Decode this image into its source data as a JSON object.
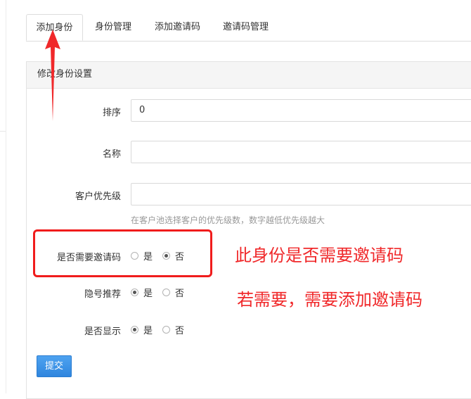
{
  "tabs": [
    {
      "label": "添加身份",
      "active": true
    },
    {
      "label": "身份管理",
      "active": false
    },
    {
      "label": "添加邀请码",
      "active": false
    },
    {
      "label": "邀请码管理",
      "active": false
    }
  ],
  "panel": {
    "title": "修改身份设置"
  },
  "form": {
    "sort": {
      "label": "排序",
      "value": "0"
    },
    "name": {
      "label": "名称",
      "value": ""
    },
    "priority": {
      "label": "客户优先级",
      "value": "",
      "hint": "在客户池选择客户的优先级数，数字越低优先级越大"
    },
    "need_invite": {
      "label": "是否需要邀请码",
      "yes": "是",
      "no": "否",
      "selected": "no"
    },
    "hidden_recommend": {
      "label": "隐号推荐",
      "yes": "是",
      "no": "否",
      "selected": "yes"
    },
    "display": {
      "label": "是否显示",
      "yes": "是",
      "no": "否",
      "selected": "yes"
    },
    "submit_label": "提交"
  },
  "annotations": {
    "note1": "此身份是否需要邀请码",
    "note2": "若需要，需要添加邀请码",
    "highlight_color": "#f01c1c"
  },
  "colors": {
    "primary": "#2f86de",
    "border": "#dddddd",
    "hint": "#999999"
  }
}
